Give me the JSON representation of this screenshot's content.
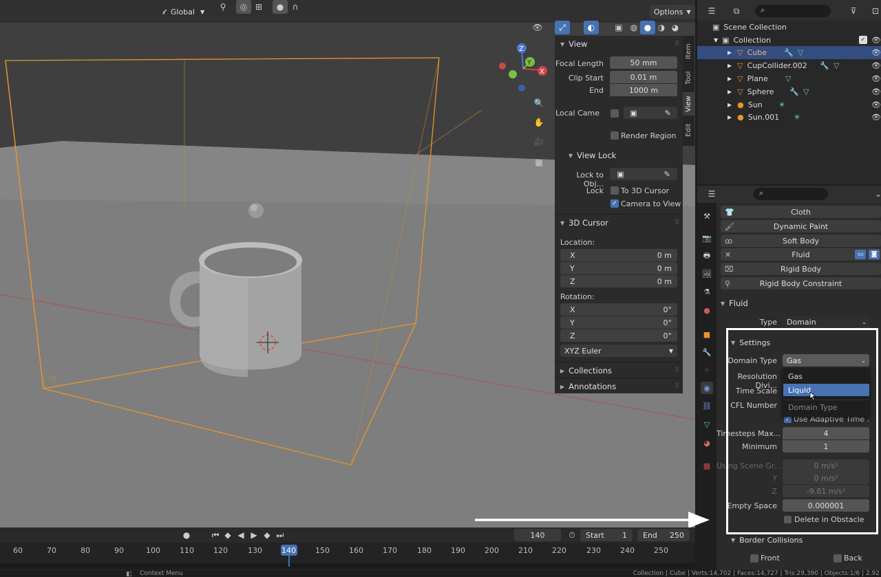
{
  "viewport": {
    "header": {
      "orientation": "Global",
      "options": "Options"
    },
    "npanel": {
      "tabs": [
        "Item",
        "Tool",
        "View",
        "Edit"
      ],
      "view": {
        "title": "View",
        "focal_length_label": "Focal Length",
        "focal_length": "50 mm",
        "clip_start_label": "Clip Start",
        "clip_start": "0.01 m",
        "end_label": "End",
        "end": "1000 m",
        "local_camera_label": "Local Came",
        "render_region_label": "Render Region"
      },
      "view_lock": {
        "title": "View Lock",
        "lock_to_obj_label": "Lock to Obj...",
        "lock_label": "Lock",
        "to_3d_cursor": "To 3D Cursor",
        "camera_to_view": "Camera to View"
      },
      "cursor": {
        "title": "3D Cursor",
        "location_label": "Location:",
        "loc": [
          {
            "axis": "X",
            "value": "0 m"
          },
          {
            "axis": "Y",
            "value": "0 m"
          },
          {
            "axis": "Z",
            "value": "0 m"
          }
        ],
        "rotation_label": "Rotation:",
        "rot": [
          {
            "axis": "X",
            "value": "0°"
          },
          {
            "axis": "Y",
            "value": "0°"
          },
          {
            "axis": "Z",
            "value": "0°"
          }
        ],
        "rotation_mode": "XYZ Euler"
      },
      "collections": "Collections",
      "annotations": "Annotations"
    }
  },
  "outliner": {
    "scene_collection": "Scene Collection",
    "collection": "Collection",
    "items": [
      {
        "name": "Cube",
        "selected": true
      },
      {
        "name": "CupCollider.002",
        "selected": false
      },
      {
        "name": "Plane",
        "selected": false
      },
      {
        "name": "Sphere",
        "selected": false
      },
      {
        "name": "Sun",
        "selected": false
      },
      {
        "name": "Sun.001",
        "selected": false
      }
    ]
  },
  "properties": {
    "physics_buttons": [
      "Cloth",
      "Dynamic Paint",
      "Soft Body",
      "Fluid",
      "Rigid Body",
      "Rigid Body Constraint"
    ],
    "fluid_title": "Fluid",
    "type_label": "Type",
    "type_value": "Domain",
    "settings_title": "Settings",
    "domain_type_label": "Domain Type",
    "domain_type_value": "Gas",
    "resolution_label": "Resolution Divi...",
    "time_scale_label": "Time Scale",
    "cfl_label": "CFL Number",
    "adaptive_label": "Use Adaptive Time ...",
    "timesteps_max_label": "Timesteps Max...",
    "timesteps_max": "4",
    "minimum_label": "Minimum",
    "minimum": "1",
    "gravity_label": "Using Scene Gr...",
    "gravity": [
      {
        "axis": "",
        "value": "0 m/s²"
      },
      {
        "axis": "Y",
        "value": "0 m/s²"
      },
      {
        "axis": "Z",
        "value": "-9.81 m/s²"
      }
    ],
    "empty_space_label": "Empty Space",
    "empty_space": "0.000001",
    "delete_in_obstacle": "Delete in Obstacle",
    "border_collisions": "Border Collisions",
    "front": "Front",
    "back": "Back"
  },
  "menu": {
    "items": [
      "Gas",
      "Liquid"
    ],
    "highlighted": "Liquid",
    "footer": "Domain Type"
  },
  "timeline": {
    "current_frame": "140",
    "start_label": "Start",
    "start": "1",
    "end_label": "End",
    "end": "250",
    "ticks": [
      "60",
      "70",
      "80",
      "90",
      "100",
      "110",
      "120",
      "130",
      "140",
      "150",
      "160",
      "170",
      "180",
      "190",
      "200",
      "210",
      "220",
      "230",
      "240",
      "250"
    ]
  },
  "statusbar": {
    "left": "Context Menu",
    "right": "Collection | Cube | Verts:14,702 | Faces:14,727 | Tris:29,390 | Objects:1/6 | 2.92"
  },
  "colors": {
    "accent": "#4772b3",
    "selection_orange": "#e8962c",
    "annotation_box": "#ffffff"
  }
}
